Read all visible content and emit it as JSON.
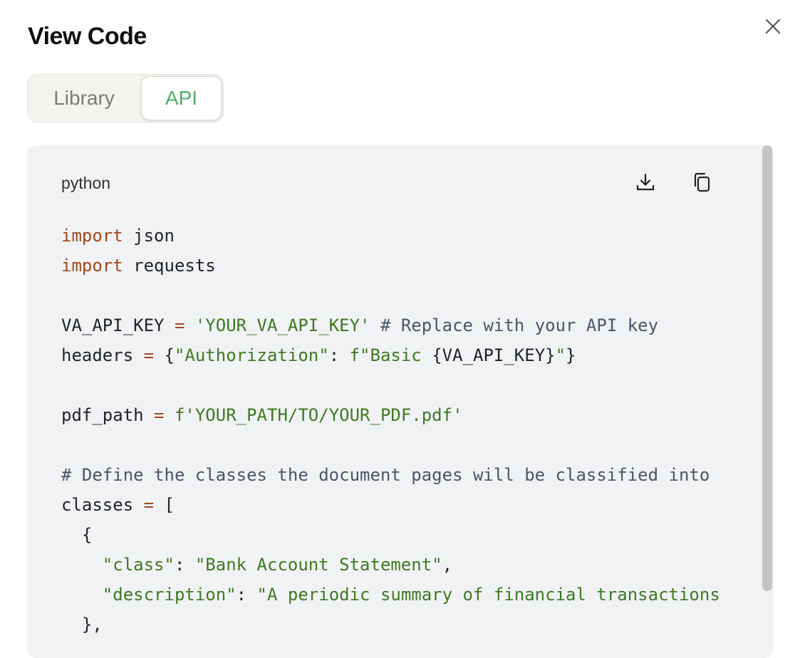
{
  "dialog": {
    "title": "View Code"
  },
  "tabs": [
    {
      "label": "Library",
      "active": false
    },
    {
      "label": "API",
      "active": true
    }
  ],
  "code_block": {
    "language": "python",
    "actions": [
      "download-icon",
      "copy-icon"
    ],
    "lines": {
      "l1": {
        "a": "import",
        "b": " json"
      },
      "l2": {
        "a": "import",
        "b": " requests"
      },
      "l4": {
        "a": "VA_API_KEY ",
        "b": "=",
        "c": " ",
        "d": "'YOUR_VA_API_KEY'",
        "e": " # Replace with your API key"
      },
      "l5": {
        "a": "headers ",
        "b": "=",
        "c": " {",
        "d": "\"Authorization\"",
        "e": ": ",
        "f": "f\"Basic ",
        "g": "{VA_API_KEY}",
        "h": "\"",
        "i": "}"
      },
      "l7": {
        "a": "pdf_path ",
        "b": "=",
        "c": " ",
        "d": "f'YOUR_PATH/TO/YOUR_PDF.pdf'"
      },
      "l9": {
        "a": "# Define the classes the document pages will be classified into"
      },
      "l10": {
        "a": "classes ",
        "b": "=",
        "c": " ["
      },
      "l11": {
        "a": "  {"
      },
      "l12": {
        "a": "    ",
        "b": "\"class\"",
        "c": ": ",
        "d": "\"Bank Account Statement\"",
        "e": ","
      },
      "l13": {
        "a": "    ",
        "b": "\"description\"",
        "c": ": ",
        "d": "\"A periodic summary of financial transactions"
      },
      "l14": {
        "a": "  },"
      }
    }
  },
  "colors": {
    "accent_tab": "#4caf68",
    "keyword": "#a0461f",
    "string": "#3d7a21",
    "comment": "#4b5568",
    "panel_bg": "#f1f2f4"
  }
}
